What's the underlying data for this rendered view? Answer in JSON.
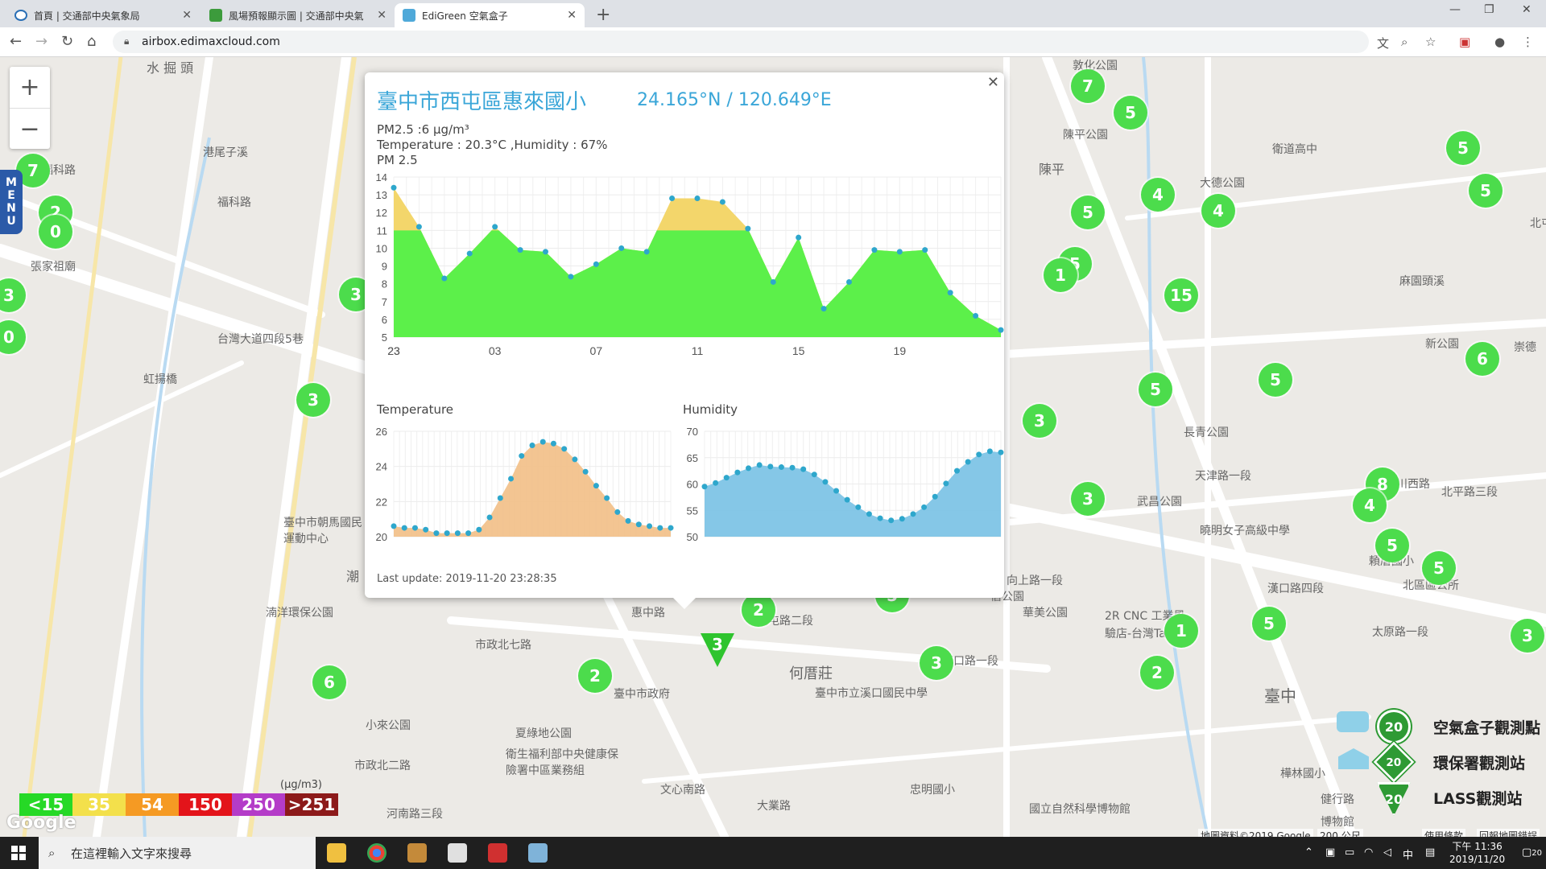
{
  "tabs": [
    {
      "title": "首頁 | 交通部中央氣象局",
      "active": false
    },
    {
      "title": "風場預報顯示圖 | 交通部中央氣",
      "active": false
    },
    {
      "title": "EdiGreen 空氣盒子",
      "active": true
    }
  ],
  "address": {
    "url": "airbox.edimaxcloud.com"
  },
  "map_labels": [
    "水 掘 頭",
    "福科路",
    "張家祖廟",
    "福科路",
    "港尾子溪",
    "台灣大道四段5巷",
    "虹揚橋",
    "臺中市朝馬國民運動中心",
    "潮",
    "湳洋環保公園",
    "市政北七路",
    "惠中路",
    "臺中市政府",
    "夏綠地公園",
    "衛生福利部中央健康保險署中區業務組",
    "小來公園",
    "市政北二路",
    "河南路三段",
    "文心南路",
    "大業路",
    "何厝莊",
    "臺中市立溪口國民中學",
    "國立自然科學博物館",
    "忠明國小",
    "向上路一段",
    "西屯路二段",
    "漢口路一段",
    "陳平",
    "陳平公園",
    "敦化公園",
    "大德公園",
    "衛道高中",
    "麻園頭溪",
    "新公園",
    "崇德",
    "北屯",
    "長青公園",
    "天津路一段",
    "曉明女子高級中學",
    "武昌公園",
    "漢口路四段",
    "北區區公所",
    "頼厝國小",
    "太原路一段",
    "信公園",
    "2R CNC 工業風",
    "驗店-台灣Taiwan",
    "華美公園",
    "臺中",
    "健行路",
    "博物館",
    "樺林國小",
    "柳川西路",
    "北平路三段"
  ],
  "popup": {
    "title": "臺中市西屯區惠來國小",
    "coordinates": "24.165°N / 120.649°E",
    "pm25_text": "PM2.5 :6 μg/m³",
    "temp_humidity_text": "Temperature : 20.3°C ,Humidity : 67%",
    "chart_label_pm": "PM 2.5",
    "chart_label_temp": "Temperature",
    "chart_label_hum": "Humidity",
    "last_update": "Last update: 2019-11-20 23:28:35"
  },
  "chart_data": [
    {
      "type": "area",
      "title": "PM 2.5",
      "x": [
        "23",
        "00",
        "01",
        "02",
        "03",
        "04",
        "05",
        "06",
        "07",
        "08",
        "09",
        "10",
        "11",
        "12",
        "13",
        "14",
        "15",
        "16",
        "17",
        "18",
        "19",
        "20",
        "21",
        "22",
        "23"
      ],
      "xticks": [
        "23",
        "03",
        "07",
        "11",
        "15",
        "19",
        "23"
      ],
      "values": [
        13.4,
        11.2,
        8.3,
        9.7,
        11.2,
        9.9,
        9.8,
        8.4,
        9.1,
        10.0,
        9.8,
        12.8,
        12.8,
        12.6,
        11.1,
        8.1,
        10.6,
        6.6,
        8.1,
        9.9,
        9.8,
        9.9,
        7.5,
        6.2,
        5.4
      ],
      "ylim": [
        5,
        14
      ],
      "yticks": [
        5,
        6,
        7,
        8,
        9,
        10,
        11,
        12,
        13,
        14
      ],
      "threshold": 11,
      "color_low": "#5cf04a",
      "color_high": "#f3d66b"
    },
    {
      "type": "area",
      "title": "Temperature",
      "values": [
        20.6,
        20.5,
        20.5,
        20.4,
        20.2,
        20.2,
        20.2,
        20.2,
        20.4,
        21.1,
        22.2,
        23.3,
        24.6,
        25.2,
        25.4,
        25.3,
        25.0,
        24.4,
        23.7,
        22.9,
        22.2,
        21.4,
        20.9,
        20.7,
        20.6,
        20.5,
        20.5
      ],
      "ylim": [
        20,
        26
      ],
      "yticks": [
        20,
        22,
        24,
        26
      ],
      "color": "#f2bf86"
    },
    {
      "type": "area",
      "title": "Humidity",
      "values": [
        59.5,
        60.2,
        61.2,
        62.2,
        63,
        63.6,
        63.3,
        63.2,
        63.1,
        62.8,
        61.8,
        60.4,
        58.7,
        57,
        55.6,
        54.3,
        53.5,
        53.1,
        53.4,
        54.3,
        55.6,
        57.6,
        60.1,
        62.5,
        64.2,
        65.6,
        66.2,
        66
      ],
      "ylim": [
        50,
        70
      ],
      "yticks": [
        50,
        55,
        60,
        65,
        70
      ],
      "color": "#7ec4e6"
    }
  ],
  "map_markers": [
    "7",
    "2",
    "0",
    "3",
    "0",
    "3",
    "3",
    "5",
    "7",
    "5",
    "5",
    "4",
    "4",
    "5",
    "1",
    "15",
    "5",
    "5",
    "5",
    "5",
    "6",
    "3",
    "3",
    "8",
    "4",
    "5",
    "5",
    "5",
    "2",
    "5",
    "3",
    "1",
    "2",
    "3",
    "2",
    "6",
    "4",
    "3"
  ],
  "aqi_legend": {
    "unit": "(μg/m3)",
    "levels": [
      "<15",
      "35",
      "54",
      "150",
      "250",
      ">251"
    ],
    "colors": [
      "#26d926",
      "#f3e04b",
      "#f59a23",
      "#e3141a",
      "#b43cc8",
      "#8c1a1a"
    ]
  },
  "legend": [
    {
      "label": "空氣盒子觀測點",
      "count": "20"
    },
    {
      "label": "環保署觀測站",
      "count": "20"
    },
    {
      "label": "LASS觀測站",
      "count": "20"
    }
  ],
  "attribution": {
    "data": "地圖資料©2019 Google",
    "scale": "200 公尺",
    "terms": "使用條款",
    "report": "回報地圖錯誤"
  },
  "taskbar": {
    "search_placeholder": "在這裡輸入文字來搜尋",
    "time": "下午 11:36",
    "date": "2019/11/20",
    "ime": "中",
    "notif": "20"
  }
}
